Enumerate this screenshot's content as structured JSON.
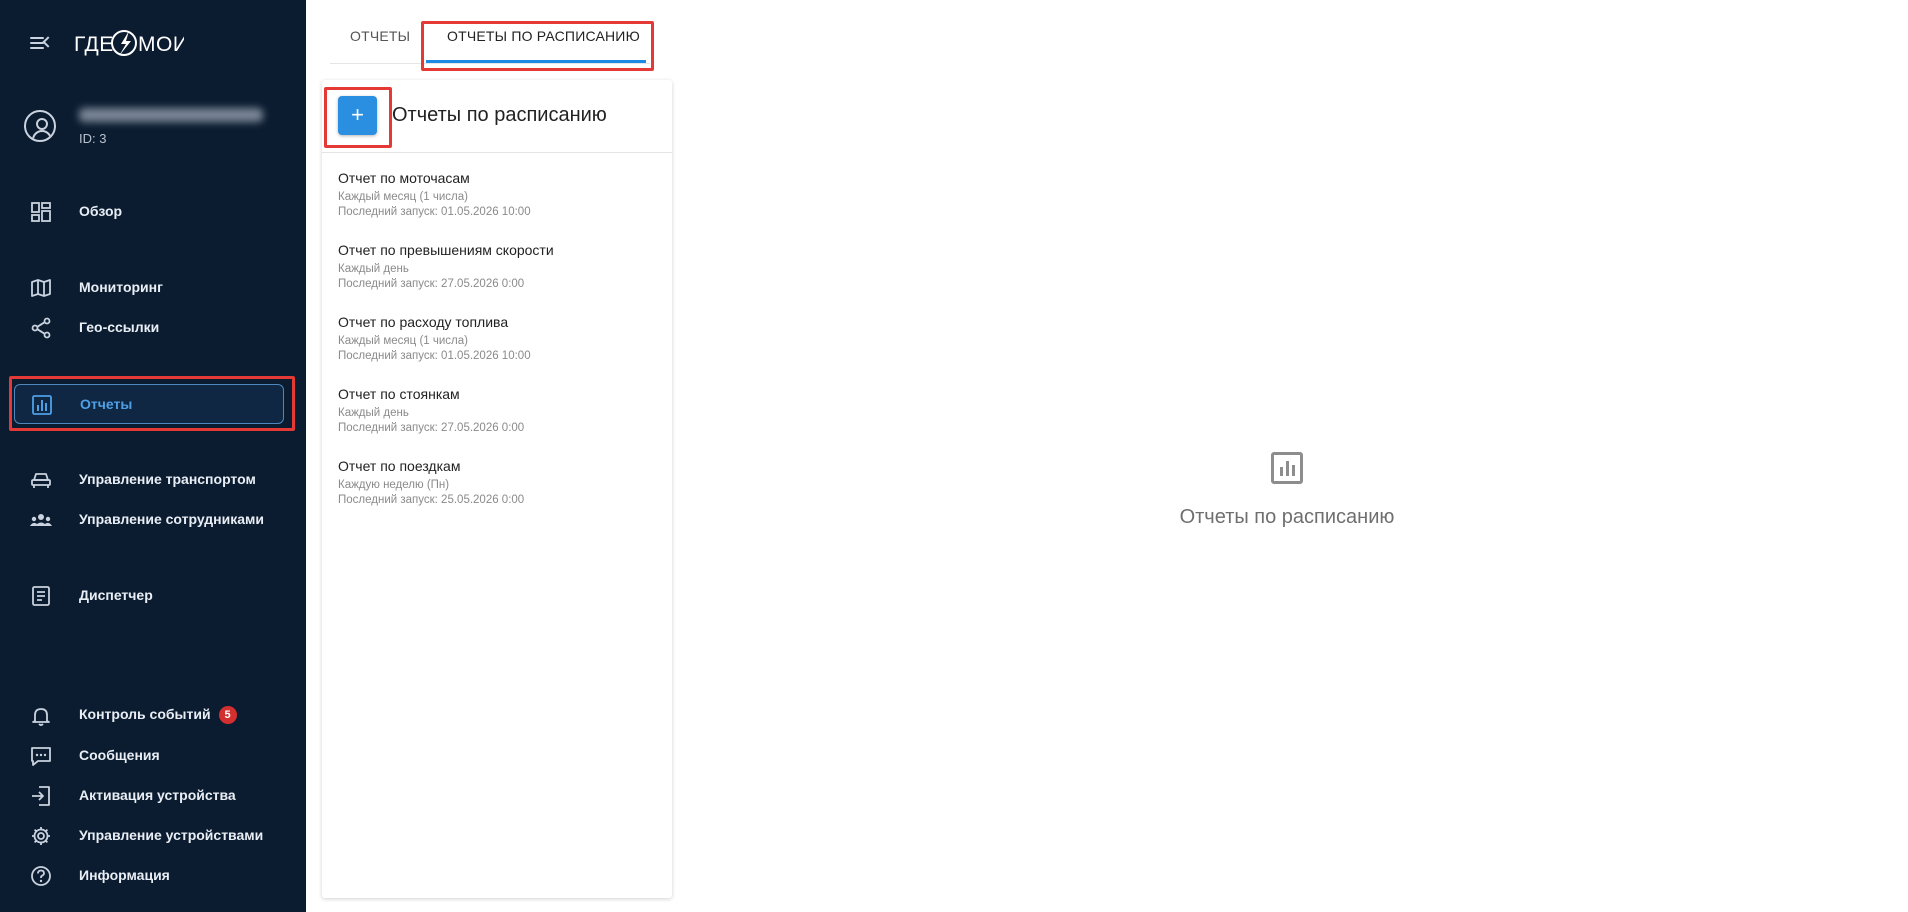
{
  "app": {
    "logo_text": "ГДЕ МОИ"
  },
  "profile": {
    "id_label": "ID: 3"
  },
  "sidebar": {
    "items": [
      {
        "label": "Обзор",
        "icon": "dashboard-icon"
      },
      {
        "label": "Мониторинг",
        "icon": "map-icon"
      },
      {
        "label": "Гео-ссылки",
        "icon": "share-icon"
      },
      {
        "label": "Отчеты",
        "icon": "bar-chart-icon",
        "active": true
      },
      {
        "label": "Управление транспортом",
        "icon": "car-icon"
      },
      {
        "label": "Управление сотрудниками",
        "icon": "people-icon"
      },
      {
        "label": "Диспетчер",
        "icon": "document-list-icon"
      },
      {
        "label": "Контроль событий",
        "icon": "bell-icon",
        "badge": "5"
      },
      {
        "label": "Сообщения",
        "icon": "chat-icon"
      },
      {
        "label": "Активация устройства",
        "icon": "login-icon"
      },
      {
        "label": "Управление устройствами",
        "icon": "gear-icon"
      },
      {
        "label": "Информация",
        "icon": "help-icon"
      }
    ]
  },
  "tabs": [
    {
      "label": "ОТЧЕТЫ",
      "active": false
    },
    {
      "label": "ОТЧЕТЫ ПО РАСПИСАНИЮ",
      "active": true
    }
  ],
  "panel": {
    "add_label": "+",
    "title": "Отчеты по расписанию",
    "reports": [
      {
        "name": "Отчет по моточасам",
        "schedule": "Каждый месяц (1 числа)",
        "last_run": "Последний запуск: 01.05.2026 10:00"
      },
      {
        "name": "Отчет по превышениям скорости",
        "schedule": "Каждый день",
        "last_run": "Последний запуск: 27.05.2026 0:00"
      },
      {
        "name": "Отчет по расходу топлива",
        "schedule": "Каждый месяц (1 числа)",
        "last_run": "Последний запуск: 01.05.2026 10:00"
      },
      {
        "name": "Отчет по стоянкам",
        "schedule": "Каждый день",
        "last_run": "Последний запуск: 27.05.2026 0:00"
      },
      {
        "name": "Отчет по поездкам",
        "schedule": "Каждую неделю (Пн)",
        "last_run": "Последний запуск: 25.05.2026 0:00"
      }
    ]
  },
  "empty_state": {
    "text": "Отчеты по расписанию",
    "icon": "bar-chart-icon"
  },
  "colors": {
    "sidebar_bg": "#0c1c30",
    "accent": "#2a8fe0",
    "highlight": "#e53935",
    "badge": "#d32f2f"
  }
}
